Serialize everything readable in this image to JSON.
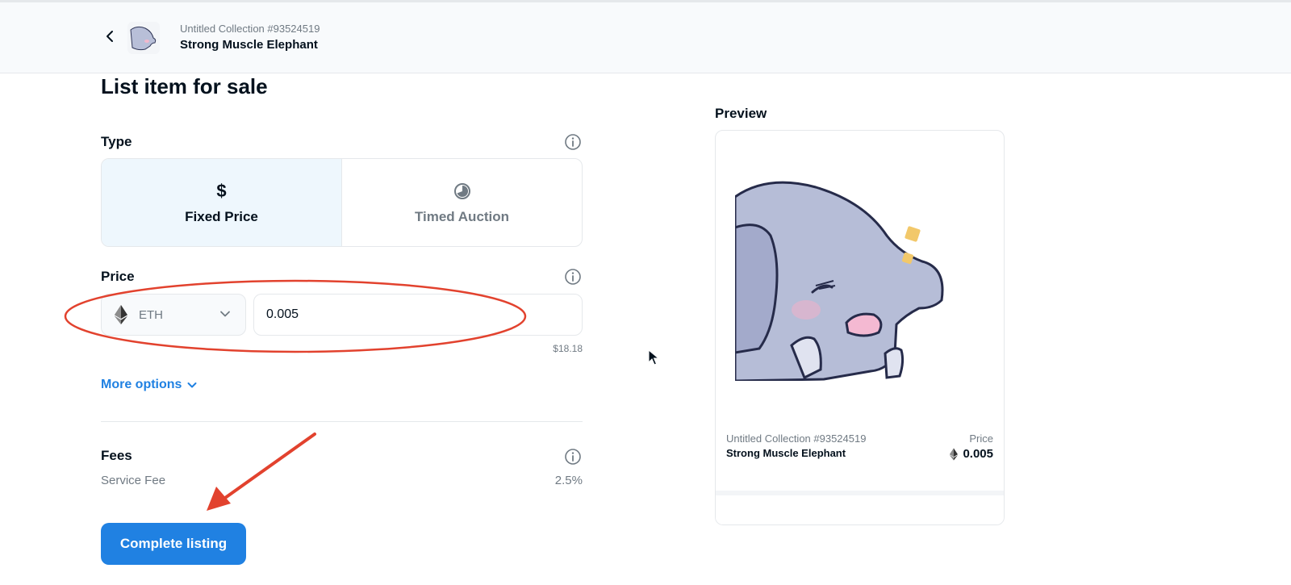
{
  "header": {
    "collection": "Untitled Collection #93524519",
    "item_name": "Strong Muscle Elephant"
  },
  "main": {
    "title": "List item for sale",
    "type_section": {
      "label": "Type",
      "options": [
        {
          "label": "Fixed Price",
          "icon": "dollar-icon",
          "selected": true
        },
        {
          "label": "Timed Auction",
          "icon": "clock-icon",
          "selected": false
        }
      ]
    },
    "price_section": {
      "label": "Price",
      "currency": "ETH",
      "amount": "0.005",
      "usd_value": "$18.18"
    },
    "more_options": "More options",
    "fees_section": {
      "label": "Fees",
      "service_fee_label": "Service Fee",
      "service_fee_value": "2.5%"
    },
    "complete_button": "Complete listing"
  },
  "preview": {
    "title": "Preview",
    "collection": "Untitled Collection #93524519",
    "item_name": "Strong Muscle Elephant",
    "price_label": "Price",
    "price": "0.005"
  },
  "colors": {
    "accent": "#2081e2",
    "annotation": "#e2422e",
    "selected_bg": "#eef7fd"
  }
}
